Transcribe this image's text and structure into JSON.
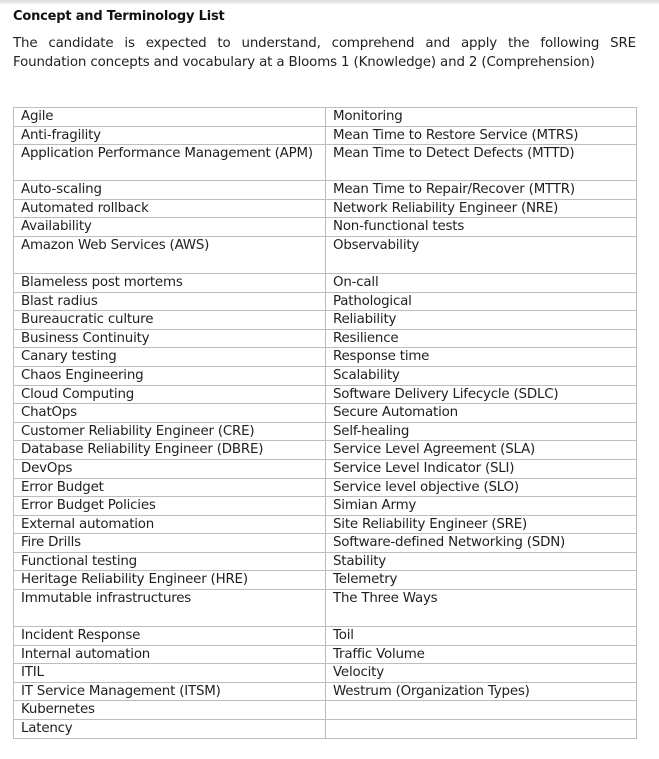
{
  "document": {
    "heading": "Concept and Terminology List",
    "intro": "The candidate is expected to understand, comprehend and apply the following SRE Foundation concepts and vocabulary at a Blooms 1 (Knowledge) and 2 (Comprehension)"
  },
  "table": {
    "rows": [
      {
        "left": "Agile",
        "right": "Monitoring",
        "kind": "norm"
      },
      {
        "left": "Anti-fragility",
        "right": "Mean Time to Restore Service (MTRS)",
        "kind": "norm"
      },
      {
        "left": "Application Performance Management (APM)",
        "right": "Mean Time to Detect Defects (MTTD)",
        "kind": "double"
      },
      {
        "left": "Auto-scaling",
        "right": "Mean Time to Repair/Recover (MTTR)",
        "kind": "norm"
      },
      {
        "left": "Automated rollback",
        "right": "Network Reliability Engineer (NRE)",
        "kind": "norm"
      },
      {
        "left": "Availability",
        "right": "Non-functional tests",
        "kind": "norm"
      },
      {
        "left": "Amazon Web Services (AWS)",
        "right": "Observability",
        "kind": "tall"
      },
      {
        "left": "Blameless post mortems",
        "right": "On-call",
        "kind": "norm"
      },
      {
        "left": "Blast radius",
        "right": "Pathological",
        "kind": "norm"
      },
      {
        "left": "Bureaucratic culture",
        "right": "Reliability",
        "kind": "norm"
      },
      {
        "left": "Business Continuity",
        "right": "Resilience",
        "kind": "norm"
      },
      {
        "left": "Canary testing",
        "right": "Response time",
        "kind": "norm"
      },
      {
        "left": "Chaos Engineering",
        "right": "Scalability",
        "kind": "norm"
      },
      {
        "left": "Cloud Computing",
        "right": "Software Delivery Lifecycle (SDLC)",
        "kind": "norm"
      },
      {
        "left": "ChatOps",
        "right": "Secure Automation",
        "kind": "norm"
      },
      {
        "left": "Customer Reliability Engineer (CRE)",
        "right": "Self-healing",
        "kind": "norm"
      },
      {
        "left": "Database Reliability Engineer (DBRE)",
        "right": "Service Level Agreement (SLA)",
        "kind": "norm"
      },
      {
        "left": "DevOps",
        "right": "Service Level Indicator (SLI)",
        "kind": "norm"
      },
      {
        "left": "Error Budget",
        "right": "Service level objective (SLO)",
        "kind": "norm"
      },
      {
        "left": "Error Budget Policies",
        "right": "Simian Army",
        "kind": "norm"
      },
      {
        "left": "External automation",
        "right": "Site Reliability Engineer (SRE)",
        "kind": "norm"
      },
      {
        "left": "Fire Drills",
        "right": "Software-defined Networking (SDN)",
        "kind": "norm"
      },
      {
        "left": "Functional testing",
        "right": "Stability",
        "kind": "norm"
      },
      {
        "left": "Heritage Reliability Engineer (HRE)",
        "right": "Telemetry",
        "kind": "norm"
      },
      {
        "left": "Immutable infrastructures",
        "right": "The Three Ways",
        "kind": "tall"
      },
      {
        "left": "Incident Response",
        "right": "Toil",
        "kind": "norm"
      },
      {
        "left": "Internal automation",
        "right": "Traffic Volume",
        "kind": "norm"
      },
      {
        "left": "ITIL",
        "right": "Velocity",
        "kind": "norm"
      },
      {
        "left": "IT Service Management (ITSM)",
        "right": "Westrum (Organization Types)",
        "kind": "norm"
      },
      {
        "left": "Kubernetes",
        "right": "",
        "kind": "norm"
      },
      {
        "left": "Latency",
        "right": "",
        "kind": "norm"
      }
    ]
  }
}
